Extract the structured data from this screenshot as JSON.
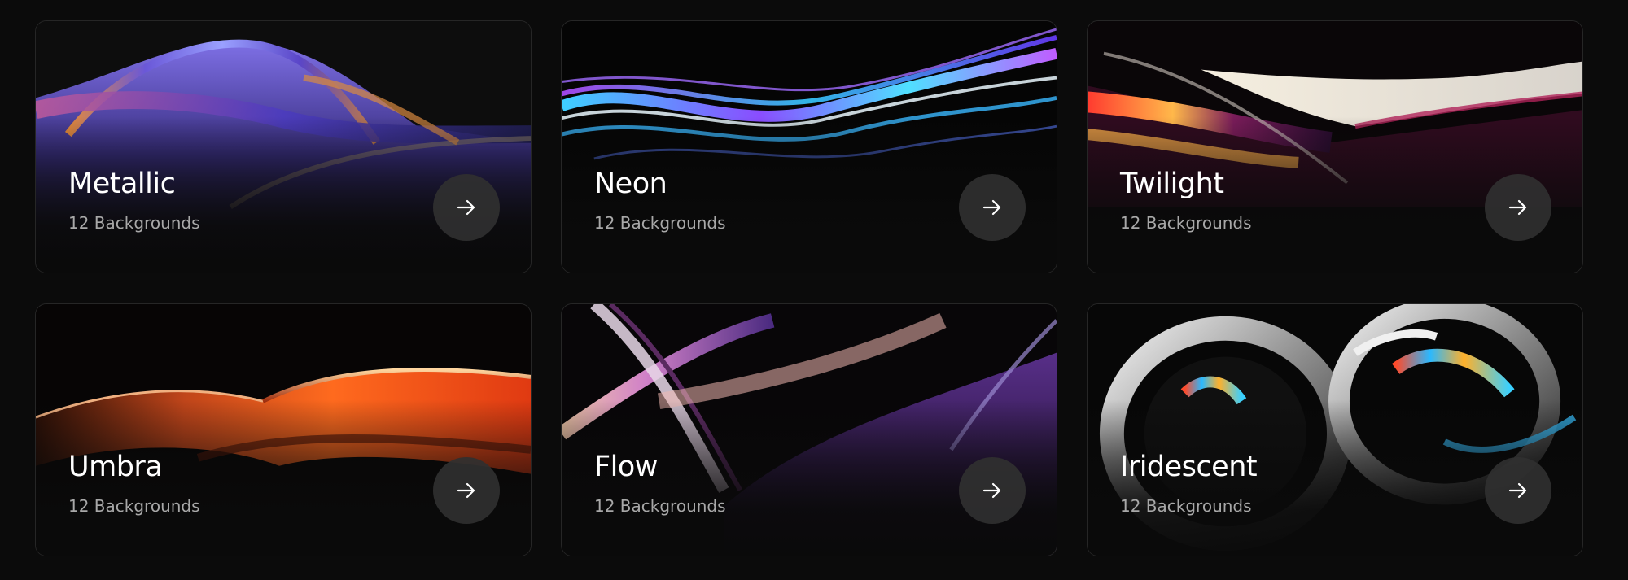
{
  "collections": [
    {
      "title": "Metallic",
      "subtitle": "12 Backgrounds",
      "icon": "arrow-right-icon"
    },
    {
      "title": "Neon",
      "subtitle": "12 Backgrounds",
      "icon": "arrow-right-icon"
    },
    {
      "title": "Twilight",
      "subtitle": "12 Backgrounds",
      "icon": "arrow-right-icon"
    },
    {
      "title": "Umbra",
      "subtitle": "12 Backgrounds",
      "icon": "arrow-right-icon"
    },
    {
      "title": "Flow",
      "subtitle": "12 Backgrounds",
      "icon": "arrow-right-icon"
    },
    {
      "title": "Iridescent",
      "subtitle": "12 Backgrounds",
      "icon": "arrow-right-icon"
    }
  ],
  "colors": {
    "page_background": "#0b0b0b",
    "card_border": "#262626",
    "title": "#ffffff",
    "subtitle": "#a8a8a8",
    "button_background": "#303030"
  }
}
